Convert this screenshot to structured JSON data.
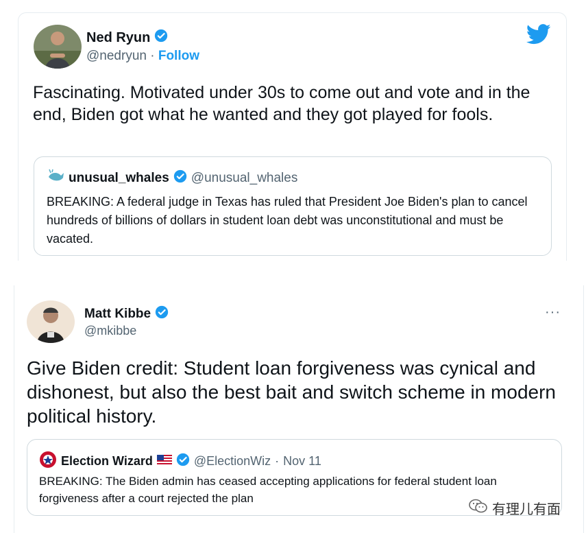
{
  "tweet1": {
    "author_name": "Ned Ryun",
    "handle": "@nedryun",
    "separator": " · ",
    "follow_label": "Follow",
    "text": "Fascinating. Motivated under 30s to come out and vote and in the end, Biden got what he wanted and they got played for fools.",
    "quote": {
      "name": "unusual_whales",
      "handle": "@unusual_whales",
      "text": "BREAKING: A federal judge in Texas has ruled that President Joe Biden's plan to cancel hundreds of billions of dollars in student loan debt was unconstitutional and must be vacated."
    },
    "icons": {
      "brand": "twitter-bird-icon",
      "verified": "verified-badge-icon"
    }
  },
  "tweet2": {
    "author_name": "Matt Kibbe",
    "handle": "@mkibbe",
    "more_label": "···",
    "text": "Give Biden credit: Student loan forgiveness was cynical and dishonest, but also the best bait and switch scheme in modern political history.",
    "quote": {
      "name": "Election Wizard",
      "handle": "@ElectionWiz",
      "separator": " · ",
      "date": "Nov 11",
      "text": "BREAKING: The Biden admin has ceased accepting applications for federal student loan forgiveness after a court rejected the plan"
    }
  },
  "watermark": {
    "text": "有理儿有面"
  },
  "colors": {
    "accent": "#1d9bf0",
    "text": "#0f1419",
    "secondary": "#536471",
    "border": "#cfd9de"
  }
}
